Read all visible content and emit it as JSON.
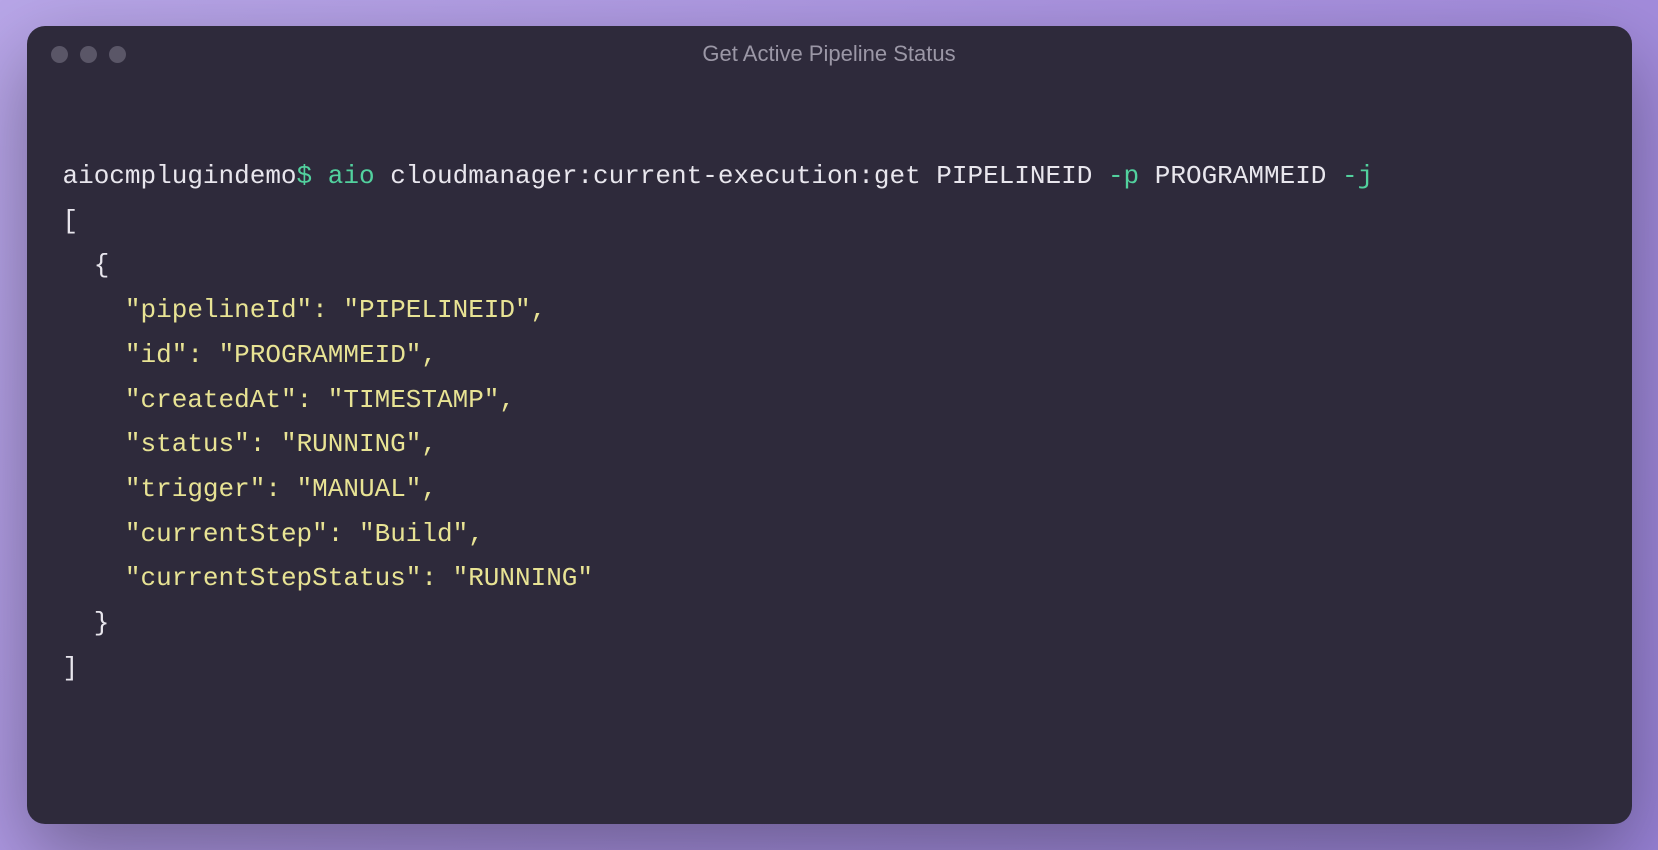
{
  "window": {
    "title": "Get Active Pipeline Status"
  },
  "prompt": {
    "host": "aiocmplugindemo",
    "symbol": "$"
  },
  "command": {
    "exec": "aio",
    "subcommand": "cloudmanager:current-execution:get",
    "arg1": "PIPELINEID",
    "flag1": "-p",
    "arg2": "PROGRAMMEID",
    "flag2": "-j"
  },
  "output": {
    "open_array": "[",
    "open_obj": "  {",
    "line1_key": "\"pipelineId\"",
    "line1_sep": ": ",
    "line1_val": "\"PIPELINEID\"",
    "line1_end": ",",
    "line2_key": "\"id\"",
    "line2_sep": ": ",
    "line2_val": "\"PROGRAMMEID\"",
    "line2_end": ",",
    "line3_key": "\"createdAt\"",
    "line3_sep": ": ",
    "line3_val": "\"TIMESTAMP\"",
    "line3_end": ",",
    "line4_key": "\"status\"",
    "line4_sep": ": ",
    "line4_val": "\"RUNNING\"",
    "line4_end": ",",
    "line5_key": "\"trigger\"",
    "line5_sep": ": ",
    "line5_val": "\"MANUAL\"",
    "line5_end": ",",
    "line6_key": "\"currentStep\"",
    "line6_sep": ": ",
    "line6_val": "\"Build\"",
    "line6_end": ",",
    "line7_key": "\"currentStepStatus\"",
    "line7_sep": ": ",
    "line7_val": "\"RUNNING\"",
    "close_obj": "  }",
    "close_array": "]",
    "indent": "    "
  }
}
